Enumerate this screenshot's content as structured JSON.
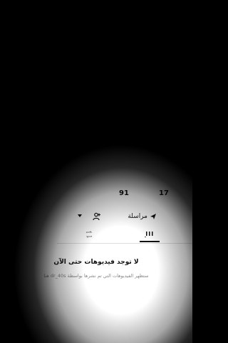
{
  "profile": {
    "stats": [
      {
        "value": "17",
        "label": ""
      },
      {
        "value": "91",
        "label": ""
      },
      {
        "value": "",
        "label": ""
      }
    ],
    "message_label": "مراسلة"
  },
  "tabs": [
    {
      "name": "videos",
      "icon": "grid-icon"
    },
    {
      "name": "reposts",
      "icon": "repost-icon"
    }
  ],
  "empty_state": {
    "title": "لا توجد فيديوهات حتى الآن",
    "subtitle": "ستظهر الفيديوهات التي تم نشرها بواسطة dr_40s هنا"
  },
  "colors": {
    "text": "#111111",
    "muted": "#888888",
    "background": "#ffffff"
  }
}
